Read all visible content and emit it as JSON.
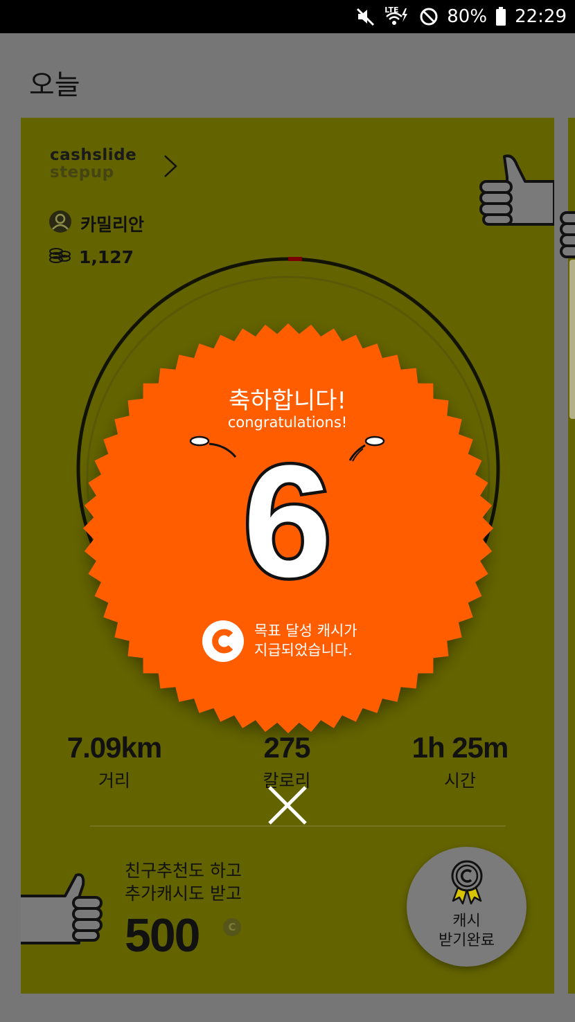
{
  "status_bar": {
    "network": "LTE",
    "battery_percent": "80%",
    "time": "22:29",
    "icons": [
      "mute-icon",
      "wifi-lte-icon",
      "do-not-disturb-icon",
      "battery-icon"
    ]
  },
  "header": {
    "title": "오늘"
  },
  "card": {
    "brand_line1": "cashslide",
    "brand_line2": "stepup",
    "user_name": "카밀리안",
    "coin_balance": "1,127"
  },
  "popup": {
    "title_ko": "축하합니다!",
    "title_en": "congratulations!",
    "goal_number": "6",
    "cash_msg_line1": "목표 달성 캐시가",
    "cash_msg_line2": "지급되었습니다.",
    "cash_icon_letter": "C"
  },
  "stats": [
    {
      "value": "7.09km",
      "label": "거리"
    },
    {
      "value": "275",
      "label": "칼로리"
    },
    {
      "value": "1h 25m",
      "label": "시간"
    }
  ],
  "promo": {
    "line1": "친구추천도 하고",
    "line2": "추가캐시도 받고",
    "amount": "500",
    "currency_letter": "C"
  },
  "reward_button": {
    "line1": "캐시",
    "line2": "받기완료"
  },
  "colors": {
    "card_bg": "#636300",
    "popup_orange": "#ff5d00",
    "background": "#767676"
  }
}
